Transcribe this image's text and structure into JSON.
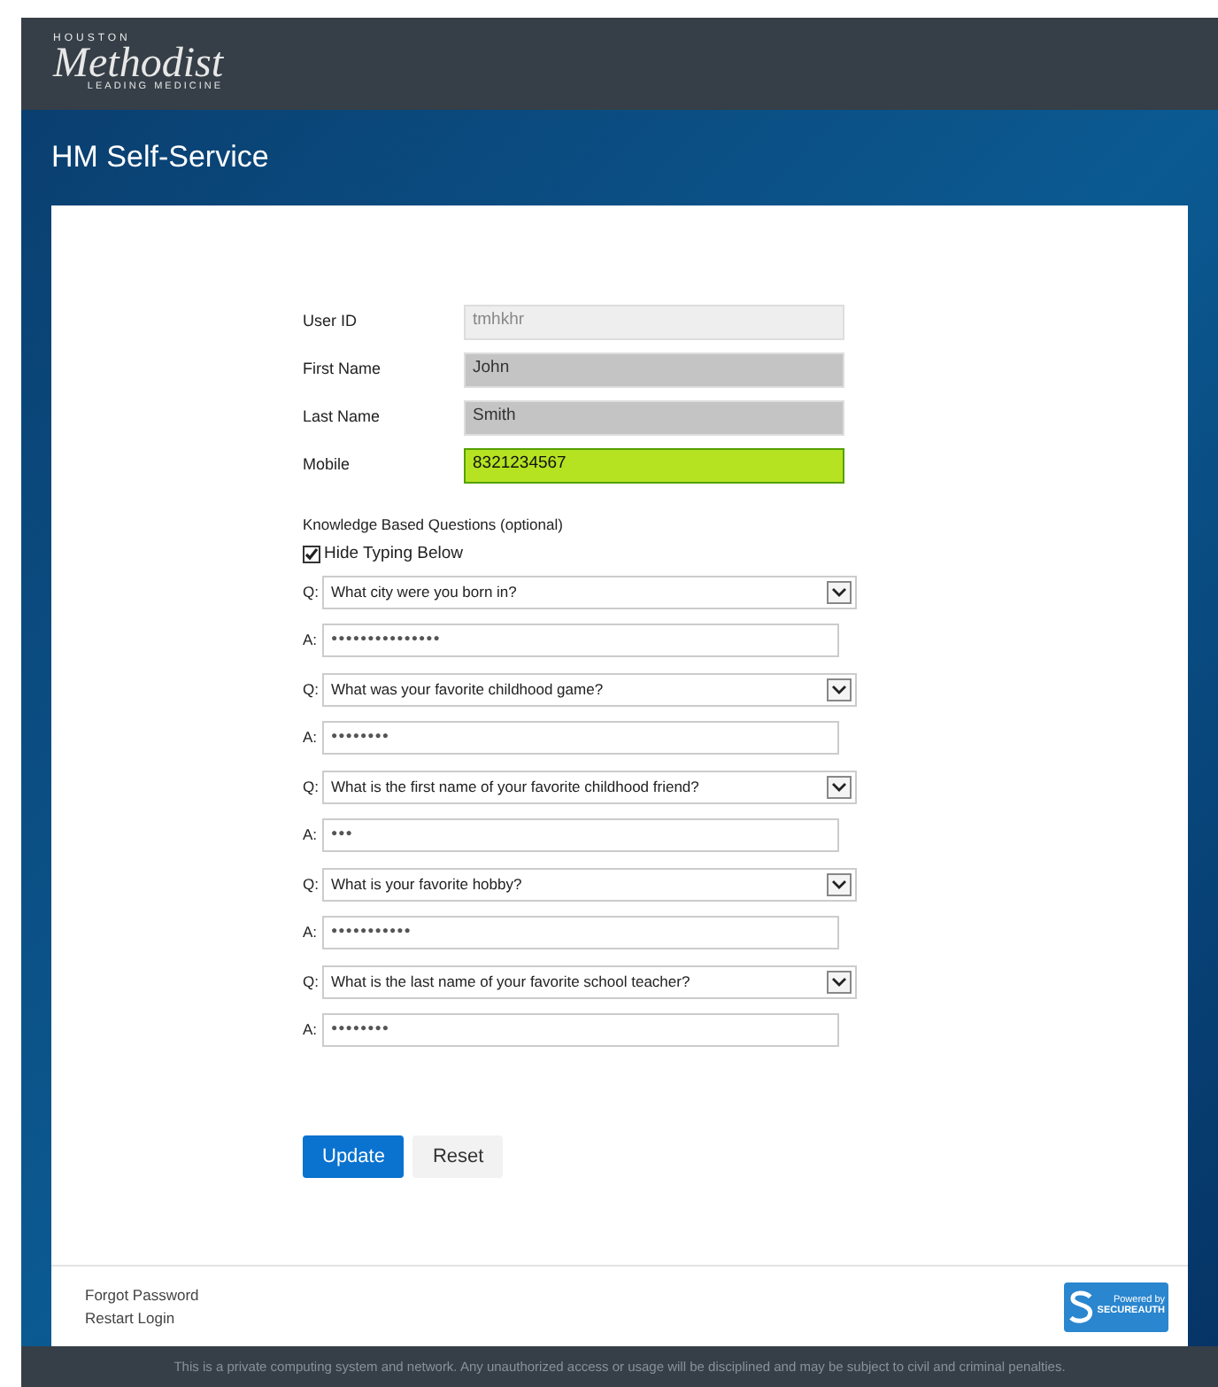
{
  "logo": {
    "top": "HOUSTON",
    "name": "Methodist",
    "tagline": "LEADING MEDICINE"
  },
  "title": "HM Self-Service",
  "fields": [
    {
      "label": "User ID",
      "value": "tmhkhr",
      "kind": "readonly"
    },
    {
      "label": "First Name",
      "value": "John",
      "kind": "filled"
    },
    {
      "label": "Last Name",
      "value": "Smith",
      "kind": "filled"
    },
    {
      "label": "Mobile",
      "value": "8321234567",
      "kind": "highlighted"
    }
  ],
  "kbq": {
    "heading": "Knowledge Based Questions (optional)",
    "hide_typing": {
      "label": "Hide Typing Below",
      "checked": true
    },
    "items": [
      {
        "q_label": "Q:",
        "question": "What city were you born in?",
        "a_label": "A:",
        "answer": "●●●●●●●●●●●●●●●"
      },
      {
        "q_label": "Q:",
        "question": "What was your favorite childhood game?",
        "a_label": "A:",
        "answer": "●●●●●●●●"
      },
      {
        "q_label": "Q:",
        "question": "What is the first name of your favorite childhood friend?",
        "a_label": "A:",
        "answer": "●●●"
      },
      {
        "q_label": "Q:",
        "question": "What is your favorite hobby?",
        "a_label": "A:",
        "answer": "●●●●●●●●●●●"
      },
      {
        "q_label": "Q:",
        "question": "What is the last name of your favorite school teacher?",
        "a_label": "A:",
        "answer": "●●●●●●●●"
      }
    ]
  },
  "buttons": [
    {
      "label": "Update",
      "kind": "primary"
    },
    {
      "label": "Reset",
      "kind": "secondary"
    }
  ],
  "links": [
    "Forgot Password",
    "Restart Login"
  ],
  "badge": {
    "line1": "Powered by",
    "line2": "SECUREAUTH"
  },
  "footer": "This is a private computing system and network. Any unauthorized access or usage will be disciplined and may be subject to civil and criminal penalties."
}
